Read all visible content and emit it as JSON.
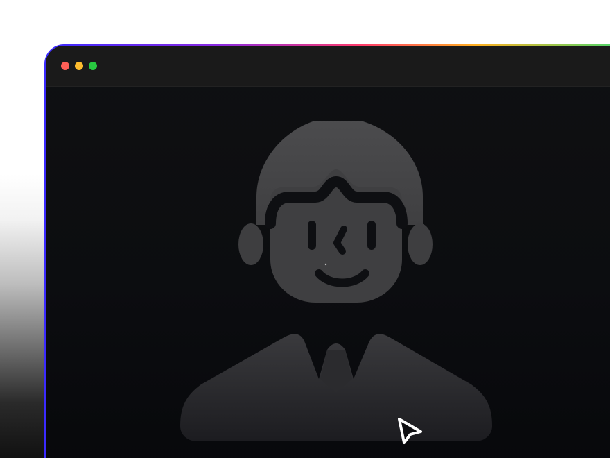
{
  "window": {
    "controls": {
      "close": "close-button",
      "minimize": "minimize-button",
      "zoom": "zoom-button"
    },
    "theme": {
      "accent": "#4a4a4a",
      "background": "#0c0d10",
      "titlebar": "#1a1a1a"
    }
  },
  "content": {
    "avatar": {
      "icon": "person-avatar-icon",
      "fill": "#4a4a4a",
      "features": "#0e0f12"
    },
    "cursor": {
      "icon": "pointer-cursor-icon",
      "color": "#ffffff"
    }
  }
}
